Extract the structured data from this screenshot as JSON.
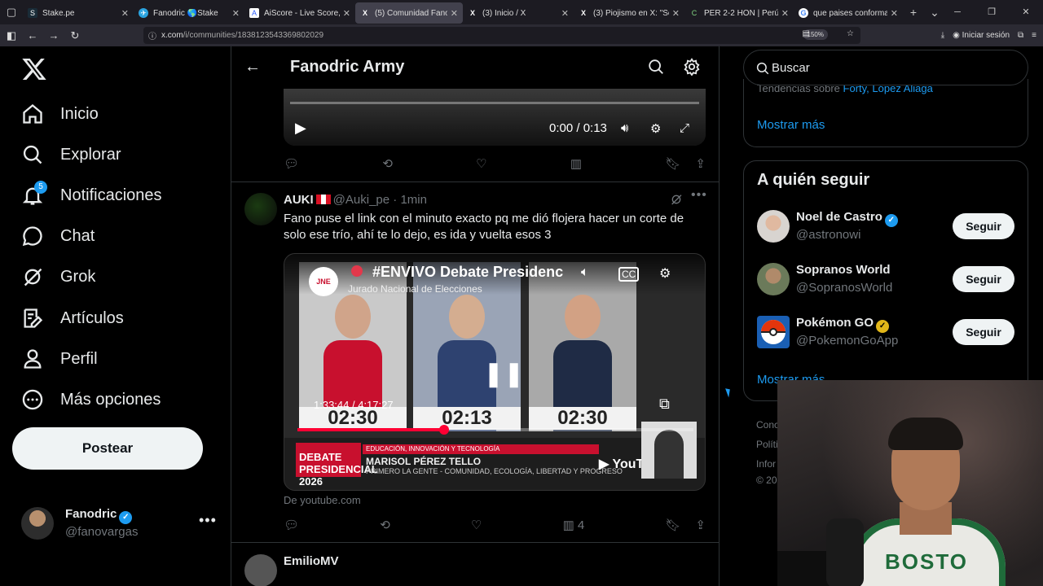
{
  "browser": {
    "tabs": [
      {
        "label": "Stake.pe",
        "icon": "S",
        "color": "#1a2c38"
      },
      {
        "label": "Fanodric 🌎Stake",
        "icon": "✈",
        "color": "#2aa3df"
      },
      {
        "label": "AiScore - Live Score, Footb",
        "icon": "A",
        "color": "#3060ff"
      },
      {
        "label": "(5) Comunidad Fanodr",
        "icon": "X",
        "color": "#000000",
        "active": true
      },
      {
        "label": "(3) Inicio / X",
        "icon": "X",
        "color": "#000000"
      },
      {
        "label": "(3) Piojismo en X: \"Señoras",
        "icon": "X",
        "color": "#000000"
      },
      {
        "label": "PER 2-2 HON | Perú vs Hon",
        "icon": "C",
        "color": "#2c5a2c"
      },
      {
        "label": "que paises conforman el pa",
        "icon": "G",
        "color": "#ffffff"
      }
    ],
    "url_host": "x.com",
    "url_path": "/i/communities/1838123543369802029",
    "zoom": "150%",
    "signin": "Iniciar sesión"
  },
  "sidebar": {
    "items": [
      {
        "label": "Inicio",
        "icon": "home-icon"
      },
      {
        "label": "Explorar",
        "icon": "search-icon"
      },
      {
        "label": "Notificaciones",
        "icon": "bell-icon",
        "badge": "5"
      },
      {
        "label": "Chat",
        "icon": "chat-icon"
      },
      {
        "label": "Grok",
        "icon": "grok-icon"
      },
      {
        "label": "Artículos",
        "icon": "articles-icon"
      },
      {
        "label": "Perfil",
        "icon": "person-icon"
      },
      {
        "label": "Más opciones",
        "icon": "more-circle-icon"
      }
    ],
    "post_label": "Postear",
    "account": {
      "name": "Fanodric",
      "handle": "@fanovargas"
    }
  },
  "header": {
    "title": "Fanodric Army"
  },
  "video1": {
    "time": "0:00 / 0:13"
  },
  "tweet": {
    "name": "AUKI",
    "handle": "@Auki_pe",
    "dot": "·",
    "time": "1min",
    "text": "Fano puse el link con el minuto exacto pq me dió flojera hacer un corte de solo ese trío, ahí te lo dejo, es ida y vuelta esos 3",
    "source": "De youtube.com",
    "views": "4",
    "youtube": {
      "channel_logo": "JNE",
      "title": "#ENVIVO Debate Presidenc",
      "channel": "Jurado Nacional de Elecciones",
      "timestamp": "1:33:44 / 4:17:27",
      "progress": 0.37,
      "clocks": [
        "02:30",
        "02:13",
        "02:30"
      ],
      "banner_left": "DEBATE PRESIDENCIAL 2026",
      "banner_strip": "EDUCACIÓN, INNOVACIÓN Y TECNOLOGÍA",
      "speaker": "MARISOL PÉREZ TELLO",
      "speaker_party": "PRIMERO LA GENTE - COMUNIDAD, ECOLOGÍA, LIBERTAD Y PROGRESO",
      "brand": "YouTube"
    }
  },
  "tweet2": {
    "name": "EmilioMV"
  },
  "right": {
    "search_placeholder": "Buscar",
    "trend_prefix": "Tendencias sobre",
    "trend_links": "Forty, López Aliaga",
    "show_more": "Mostrar más",
    "who_title": "A quién seguir",
    "who": [
      {
        "name": "Noel de Castro",
        "handle": "@astronowi",
        "verified": "blue",
        "follow": "Seguir"
      },
      {
        "name": "Sopranos World",
        "handle": "@SopranosWorld",
        "verified": "",
        "follow": "Seguir"
      },
      {
        "name": "Pokémon GO",
        "handle": "@PokemonGoApp",
        "verified": "gold",
        "follow": "Seguir"
      }
    ],
    "show_more2": "Mostrar más",
    "footer": [
      "Conc",
      "Políti",
      "Infor",
      "© 20"
    ]
  },
  "webcam": {
    "jersey_text": "BOSTO"
  }
}
